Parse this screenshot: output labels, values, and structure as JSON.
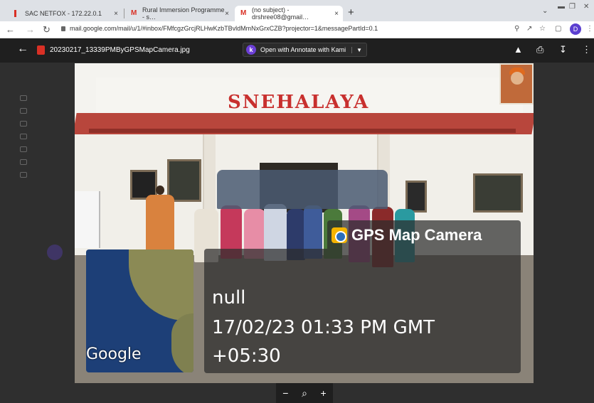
{
  "browser": {
    "tabs": [
      {
        "label": "SAC NETFOX - 172.22.0.1",
        "close": "×",
        "active": false
      },
      {
        "label": "Rural Immersion Programme - s…",
        "close": "×",
        "active": false
      },
      {
        "label": "(no subject) - drshree08@gmail…",
        "close": "×",
        "active": true
      }
    ],
    "new_tab": "+",
    "url": "mail.google.com/mail/u/1/#inbox/FMfcgzGrcjRLHwKzbTBvldMmNxGrxCZB?projector=1&messagePartId=0.1",
    "profile_initial": "D"
  },
  "viewer": {
    "file_name": "20230217_13339PMByGPSMapCamera.jpg",
    "open_with_label": "Open with Annotate with Kami",
    "open_with_icon_letter": "k"
  },
  "photo": {
    "sign_text": "SNEHALAYA",
    "gps_app_name": "GPS Map Camera",
    "location": "null",
    "datetime": "17/02/23 01:33 PM GMT",
    "timezone": "+05:30",
    "map_brand": "Google"
  },
  "zoom": {
    "out": "−",
    "search": "⌕",
    "in": "+"
  },
  "colors": {
    "accent_kami": "#6c3fd6",
    "sign_red": "#c8302e",
    "profile": "#5b3fd0"
  }
}
